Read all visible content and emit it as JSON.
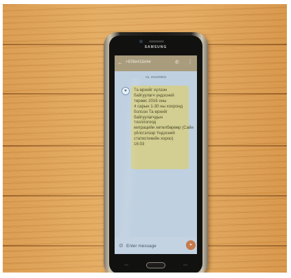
{
  "phone": {
    "brand": "SAMSUNG"
  },
  "appbar": {
    "back_icon": "arrow-back-icon",
    "sender": "+976##15###",
    "call_icon": "phone-icon",
    "menu_icon": "more-vert-icon"
  },
  "conversation": {
    "date": "Ха, 2016/08/02",
    "message_lines": [
      "Та өрхийг хүлээн",
      "байгуулагч үндэсний",
      "төрөөс 2016 оны",
      "4 сарын 1-30 ны хооронд",
      "болсон Та өрхийг",
      "байгуулагчдын",
      "тооллогоод",
      "миграцийн хөтөлбөрөөр (Сайн",
      "үйлсгэлээр Үндэсний",
      "статистикийн хороо)",
      "16:03"
    ]
  },
  "compose": {
    "attach_icon": "paperclip-icon",
    "placeholder": "Enter message",
    "send_icon": "send-icon"
  }
}
